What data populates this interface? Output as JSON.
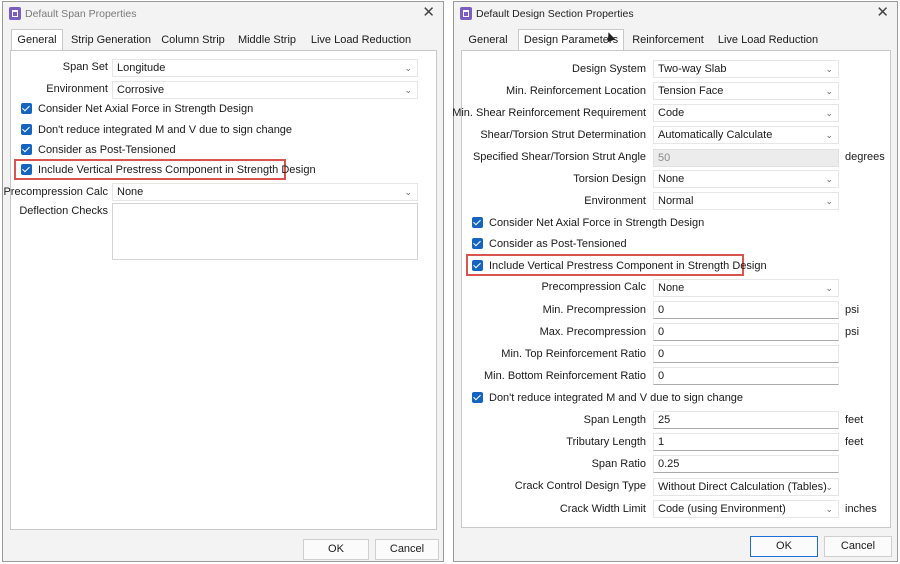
{
  "left": {
    "title": "Default Span Properties",
    "tabs": [
      "General",
      "Strip Generation",
      "Column Strip",
      "Middle Strip",
      "Live Load Reduction"
    ],
    "span_set": {
      "label": "Span Set",
      "value": "Longitude"
    },
    "environment": {
      "label": "Environment",
      "value": "Corrosive"
    },
    "checks": [
      "Consider Net Axial Force in Strength Design",
      "Don't reduce integrated M and V due to sign change",
      "Consider as Post-Tensioned",
      "Include Vertical Prestress Component in Strength Design"
    ],
    "precompression": {
      "label": "Precompression Calc",
      "value": "None"
    },
    "deflection": {
      "label": "Deflection Checks",
      "value": ""
    },
    "ok": "OK",
    "cancel": "Cancel"
  },
  "right": {
    "title": "Default Design Section Properties",
    "tabs": [
      "General",
      "Design Parameters",
      "Reinforcement",
      "Live Load Reduction"
    ],
    "design_system": {
      "label": "Design System",
      "value": "Two-way Slab"
    },
    "min_reinf_loc": {
      "label": "Min. Reinforcement Location",
      "value": "Tension Face"
    },
    "min_shear_req": {
      "label": "Min. Shear Reinforcement Requirement",
      "value": "Code"
    },
    "strut_det": {
      "label": "Shear/Torsion Strut Determination",
      "value": "Automatically Calculate"
    },
    "strut_angle": {
      "label": "Specified Shear/Torsion Strut Angle",
      "value": "50",
      "unit": "degrees"
    },
    "torsion": {
      "label": "Torsion Design",
      "value": "None"
    },
    "environment": {
      "label": "Environment",
      "value": "Normal"
    },
    "checks": [
      "Consider Net Axial Force in Strength Design",
      "Consider as Post-Tensioned",
      "Include Vertical Prestress Component in Strength Design"
    ],
    "precompression": {
      "label": "Precompression Calc",
      "value": "None"
    },
    "min_pre": {
      "label": "Min. Precompression",
      "value": "0",
      "unit": "psi"
    },
    "max_pre": {
      "label": "Max. Precompression",
      "value": "0",
      "unit": "psi"
    },
    "min_top": {
      "label": "Min. Top Reinforcement Ratio",
      "value": "0"
    },
    "min_bot": {
      "label": "Min. Bottom Reinforcement Ratio",
      "value": "0"
    },
    "dont_reduce": "Don't reduce integrated M and V due to sign change",
    "span_length": {
      "label": "Span Length",
      "value": "25",
      "unit": "feet"
    },
    "trib_length": {
      "label": "Tributary Length",
      "value": "1",
      "unit": "feet"
    },
    "span_ratio": {
      "label": "Span Ratio",
      "value": "0.25"
    },
    "crack_type": {
      "label": "Crack Control Design Type",
      "value": "Without Direct Calculation (Tables)"
    },
    "crack_limit": {
      "label": "Crack Width Limit",
      "value": "Code (using Environment)",
      "unit": "inches"
    },
    "ok": "OK",
    "cancel": "Cancel"
  },
  "colors": {
    "highlight": "#d9534f",
    "checkbox": "#1565c0",
    "default_button": "#1e6fd8"
  }
}
